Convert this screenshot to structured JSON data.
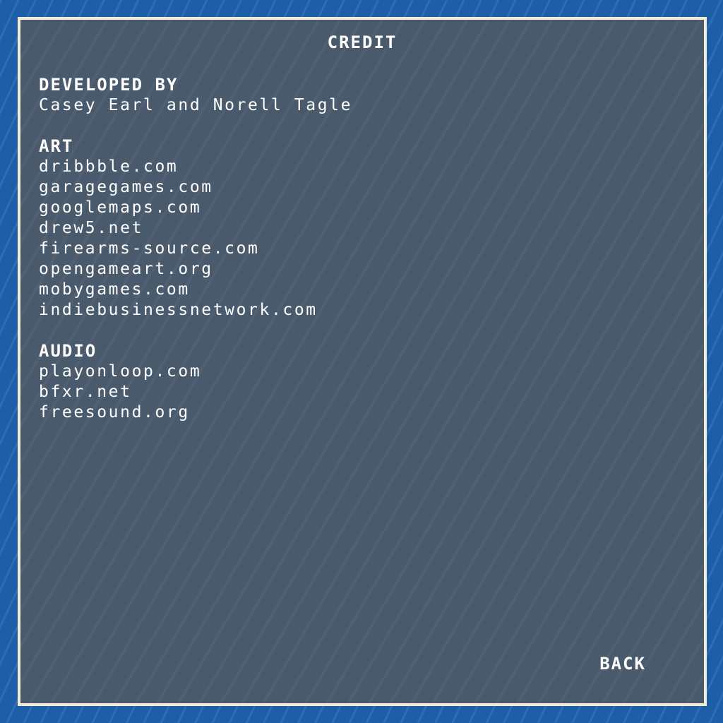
{
  "screen": {
    "title": "CREDIT",
    "back_label": "BACK"
  },
  "sections": {
    "developed": {
      "heading": "DEVELOPED BY",
      "items": [
        "Casey Earl and Norell Tagle"
      ]
    },
    "art": {
      "heading": "ART",
      "items": [
        "dribbble.com",
        "garagegames.com",
        "googlemaps.com",
        "drew5.net",
        "firearms-source.com",
        "opengameart.org",
        "mobygames.com",
        "indiebusinessnetwork.com"
      ]
    },
    "audio": {
      "heading": "AUDIO",
      "items": [
        "playonloop.com",
        "bfxr.net",
        "freesound.org"
      ]
    }
  },
  "colors": {
    "background": "#1d5ea8",
    "panel": "#4a5a6d",
    "border": "#f1ecd6",
    "text": "#ffffff"
  }
}
